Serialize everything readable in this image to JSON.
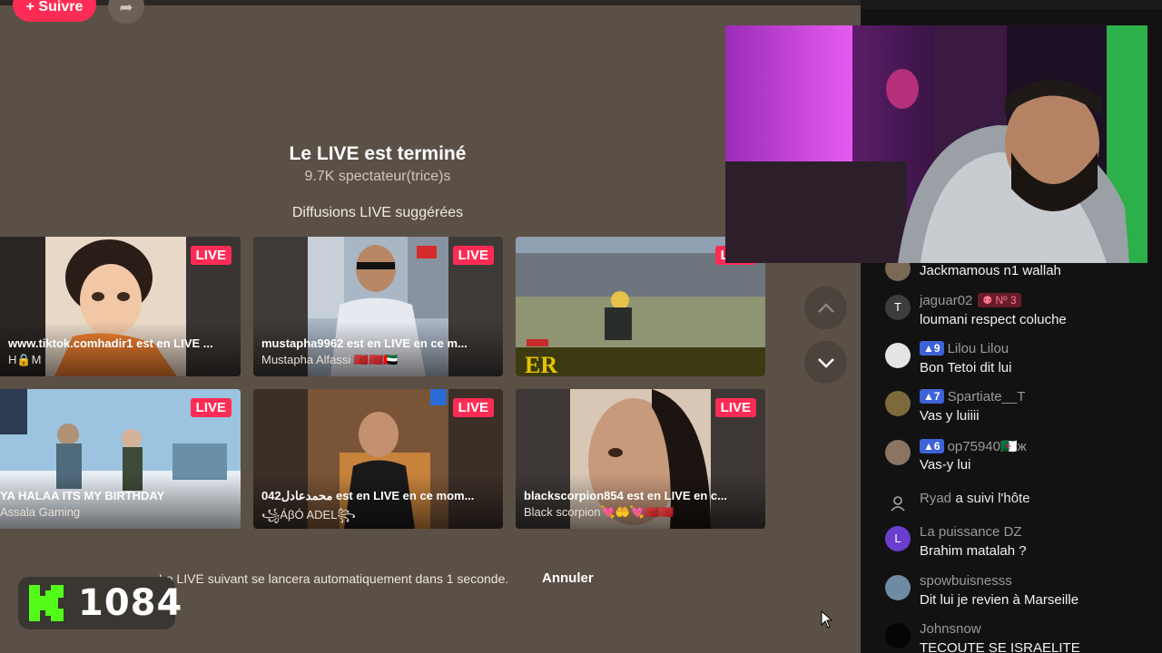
{
  "top_bar": {
    "follow_label": "+ Suivre",
    "share_icon": "share-icon"
  },
  "ended": {
    "title": "Le LIVE est terminé",
    "viewers": "9.7K spectateur(trice)s",
    "suggested_label": "Diffusions LIVE suggérées"
  },
  "live_badge": "LIVE",
  "cards": [
    {
      "title": "www.tiktok.comhadir1 est en LIVE ...",
      "subtitle": "H🔒M"
    },
    {
      "title": "mustapha9962 est en LIVE en ce m...",
      "subtitle": "Mustapha Alfassi 🇲🇦🇲🇦🇦🇪"
    },
    {
      "title": "",
      "subtitle": ""
    },
    {
      "title": "YA HALAA ITS MY BIRTHDAY",
      "subtitle": "Assala Gaming"
    },
    {
      "title": "042محمدعادل est en LIVE en ce mom...",
      "subtitle": "꧁ÁβÓ ADEL꧂"
    },
    {
      "title": "blackscorpion854 est en LIVE en c...",
      "subtitle": "Black scorpion💘🤲💘🇲🇦🇲🇦"
    }
  ],
  "game_hud_text": "ER",
  "nav": {
    "up_icon": "chevron-up-icon",
    "down_icon": "chevron-down-icon"
  },
  "autoplay": {
    "text": "Le LIVE suivant se lancera automatiquement dans 1 seconde.",
    "cancel": "Annuler"
  },
  "kick": {
    "viewer_count": "1084"
  },
  "chat": [
    {
      "user": "",
      "message": "Jackmamous n1 wallah",
      "avatar": "",
      "level": "",
      "rank": ""
    },
    {
      "user": "jaguar02",
      "message": "loumani respect coluche",
      "avatar": "T",
      "level": "",
      "rank": "Nº 3"
    },
    {
      "user": "Lilou Lilou",
      "message": "Bon Tetoi dit lui",
      "avatar": "",
      "level": "9",
      "rank": ""
    },
    {
      "user": "Spartiate__T",
      "message": "Vas y luiiii",
      "avatar": "",
      "level": "7",
      "rank": ""
    },
    {
      "user": "op75940🇩🇿ж",
      "message": "Vas-y lui",
      "avatar": "",
      "level": "6",
      "rank": ""
    },
    {
      "user": "Ryad",
      "message": "a suivi l'hôte",
      "avatar": "",
      "level": "",
      "rank": ""
    },
    {
      "user": "La puissance DZ",
      "message": "Brahim matalah ?",
      "avatar": "L",
      "level": "",
      "rank": ""
    },
    {
      "user": "spowbuisnesss",
      "message": "Dit lui je revien à Marseille",
      "avatar": "",
      "level": "",
      "rank": ""
    },
    {
      "user": "Johnsnow",
      "message": "TECOUTE SE ISRAELITE",
      "avatar": "",
      "level": "",
      "rank": ""
    }
  ]
}
